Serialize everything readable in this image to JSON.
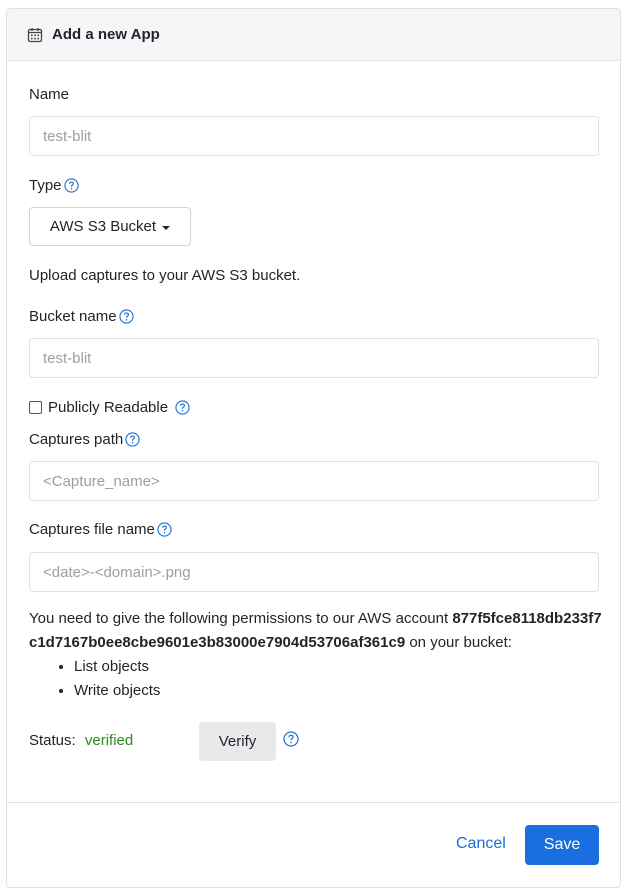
{
  "header": {
    "title": "Add a new App",
    "icon": "calendar-icon"
  },
  "name_field": {
    "label": "Name",
    "placeholder": "test-blit",
    "value": ""
  },
  "type_field": {
    "label": "Type",
    "selected": "AWS S3 Bucket",
    "description": "Upload captures to your AWS S3 bucket."
  },
  "bucket_field": {
    "label": "Bucket name",
    "placeholder": "test-blit",
    "value": ""
  },
  "public_checkbox": {
    "label": "Publicly Readable",
    "checked": false
  },
  "captures_path": {
    "label": "Captures path",
    "placeholder": "<Capture_name>",
    "value": ""
  },
  "captures_file": {
    "label": "Captures file name",
    "placeholder": "<date>-<domain>.png",
    "value": ""
  },
  "permissions": {
    "intro": "You need to give the following permissions to our AWS account",
    "account_id": "877f5fce8118db233f7c1d7167b0ee8cbe9601e3b83000e7904d53706af361c9",
    "suffix": "on your bucket:",
    "items": [
      "List objects",
      "Write objects"
    ]
  },
  "status": {
    "label": "Status:",
    "value": "verified",
    "verify_label": "Verify"
  },
  "footer": {
    "cancel_label": "Cancel",
    "save_label": "Save"
  },
  "colors": {
    "primary": "#1a6fe0",
    "link": "#1b6fd1",
    "verified": "#2e8b1f",
    "help_icon": "#1b6fd1"
  }
}
